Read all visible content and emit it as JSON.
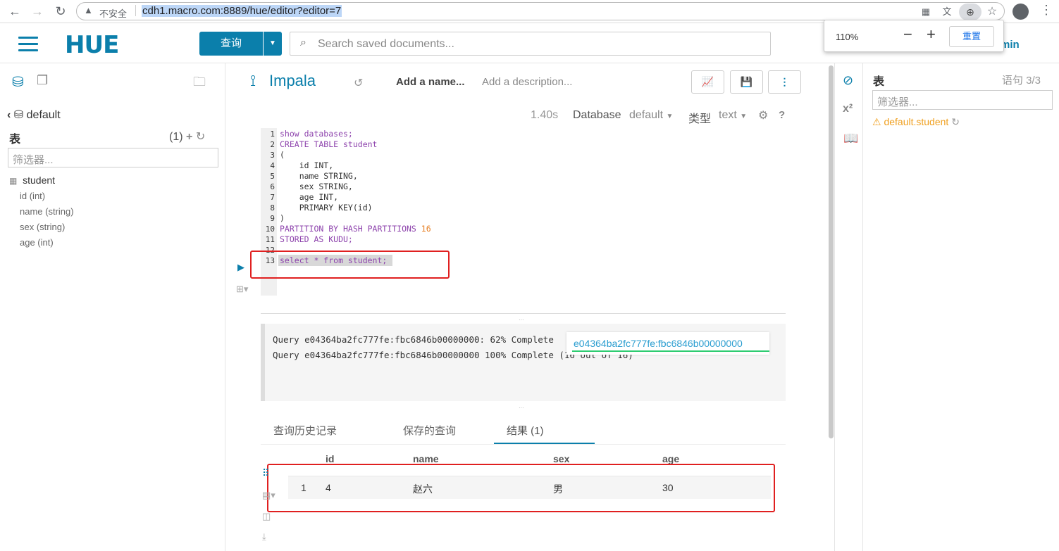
{
  "browser": {
    "security_label": "不安全",
    "url": "cdh1.macro.com:8889/hue/editor?editor=7",
    "zoom_popup": {
      "value": "110%",
      "reset_label": "重置"
    }
  },
  "header": {
    "logo": "HUE",
    "query_button": "查询",
    "search_placeholder": "Search saved documents...",
    "user_fragment": "min"
  },
  "left": {
    "database": "default",
    "tables_heading": "表",
    "tables_count": "(1)",
    "filter_placeholder": "筛选器...",
    "table_name": "student",
    "columns": [
      "id (int)",
      "name (string)",
      "sex (string)",
      "age (int)"
    ]
  },
  "editor": {
    "engine": "Impala",
    "name_placeholder": "Add a name...",
    "desc_placeholder": "Add a description...",
    "duration": "1.40s",
    "database_label": "Database",
    "database_value": "default",
    "type_label": "类型",
    "type_value": "text",
    "help": "?",
    "line_numbers": [
      "1",
      "2",
      "3",
      "4",
      "5",
      "6",
      "7",
      "8",
      "9",
      "10",
      "11",
      "12",
      "13"
    ],
    "code": {
      "l1": "show databases;",
      "l2": "CREATE TABLE student",
      "l3": "(",
      "l4": "    id INT,",
      "l5": "    name STRING,",
      "l6": "    sex STRING,",
      "l7": "    age INT,",
      "l8": "    PRIMARY KEY(id)",
      "l9": ")",
      "l10a": "PARTITION BY HASH PARTITIONS ",
      "l10b": "16",
      "l11": "STORED AS KUDU;",
      "l13": "select * from student;"
    }
  },
  "log": {
    "line1": "Query e04364ba2fc777fe:fbc6846b00000000: 62% Complete",
    "line2": "Query e04364ba2fc777fe:fbc6846b00000000 100% Complete (16 out of 16)",
    "query_id": "e04364ba2fc777fe:fbc6846b00000000"
  },
  "tabs": {
    "history": "查询历史记录",
    "saved": "保存的查询",
    "results": "结果 (1)"
  },
  "results": {
    "columns": [
      "id",
      "name",
      "sex",
      "age"
    ],
    "rows": [
      {
        "n": "1",
        "id": "4",
        "name": "赵六",
        "sex": "男",
        "age": "30"
      }
    ]
  },
  "right": {
    "title": "表",
    "statement": "语句 3/3",
    "filter_placeholder": "筛选器...",
    "warning_table": "default.student"
  }
}
